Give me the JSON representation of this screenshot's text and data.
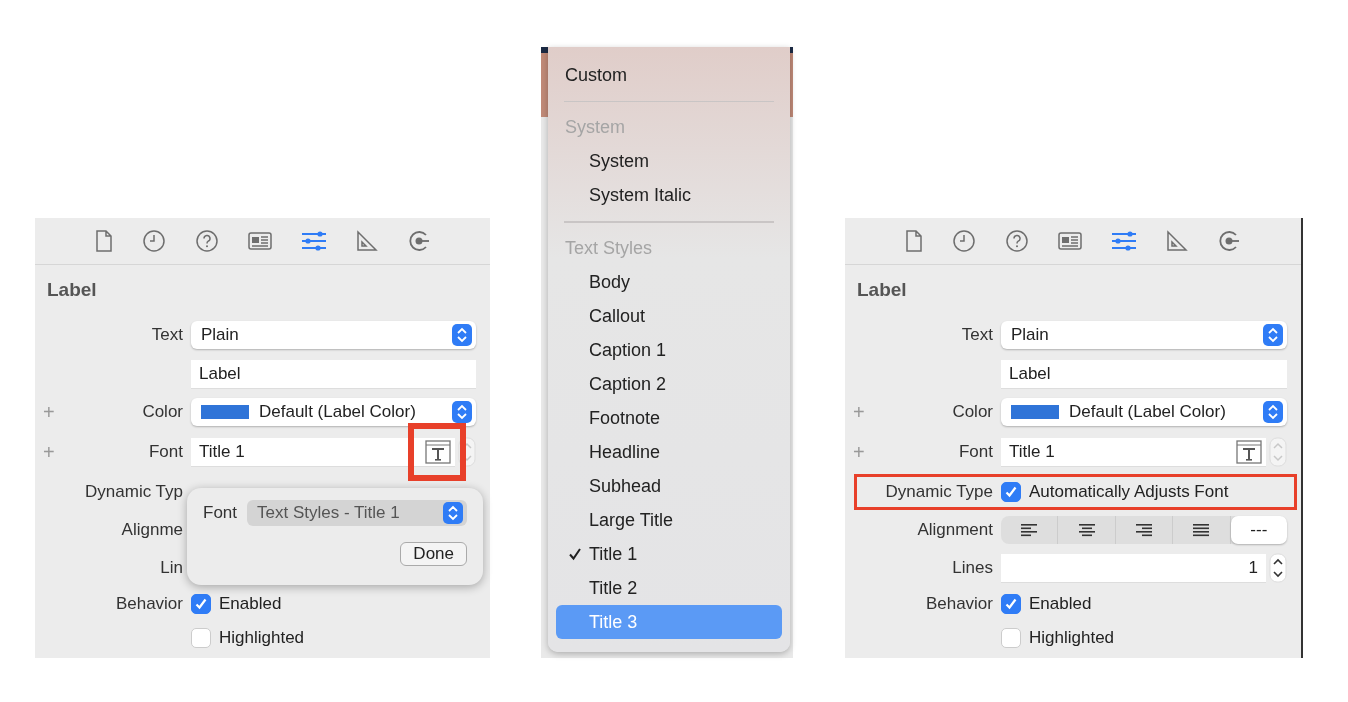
{
  "left_inspector": {
    "toolbar": [
      {
        "kind": "file",
        "selected": false
      },
      {
        "kind": "history",
        "selected": false
      },
      {
        "kind": "help",
        "selected": false
      },
      {
        "kind": "identity",
        "selected": false
      },
      {
        "kind": "attributes",
        "selected": true
      },
      {
        "kind": "size",
        "selected": false
      },
      {
        "kind": "connections",
        "selected": false
      }
    ],
    "title": "Label",
    "rows": [
      {
        "kind": "popup",
        "label": "Text",
        "value": "Plain"
      },
      {
        "kind": "text",
        "value": "Label"
      },
      {
        "kind": "color",
        "plus": "+",
        "label": "Color",
        "value": "Default (Label Color)"
      },
      {
        "kind": "font",
        "plus": "+",
        "label": "Font",
        "value": "Title 1",
        "highlighted": true
      },
      {
        "kind": "label_only",
        "label": "Dynamic Typ"
      },
      {
        "kind": "label_only",
        "label": "Alignme"
      },
      {
        "kind": "label_only",
        "label": "Lin"
      },
      {
        "kind": "check",
        "label": "Behavior",
        "text": "Enabled",
        "checked": true
      },
      {
        "kind": "check",
        "text": "Highlighted",
        "checked": false
      }
    ],
    "popover": {
      "label": "Font",
      "value": "Text Styles - Title 1",
      "button": "Done"
    }
  },
  "font_menu": {
    "items": [
      {
        "kind": "item",
        "text": "Custom",
        "checked": false,
        "selected": false,
        "indented": false
      },
      {
        "kind": "separator"
      },
      {
        "kind": "header",
        "text": "System"
      },
      {
        "kind": "item",
        "text": "System",
        "checked": false,
        "selected": false,
        "indented": true
      },
      {
        "kind": "item",
        "text": "System Italic",
        "checked": false,
        "selected": false,
        "indented": true
      },
      {
        "kind": "separator"
      },
      {
        "kind": "header",
        "text": "Text Styles"
      },
      {
        "kind": "item",
        "text": "Body",
        "checked": false,
        "selected": false,
        "indented": true
      },
      {
        "kind": "item",
        "text": "Callout",
        "checked": false,
        "selected": false,
        "indented": true
      },
      {
        "kind": "item",
        "text": "Caption 1",
        "checked": false,
        "selected": false,
        "indented": true
      },
      {
        "kind": "item",
        "text": "Caption 2",
        "checked": false,
        "selected": false,
        "indented": true
      },
      {
        "kind": "item",
        "text": "Footnote",
        "checked": false,
        "selected": false,
        "indented": true
      },
      {
        "kind": "item",
        "text": "Headline",
        "checked": false,
        "selected": false,
        "indented": true
      },
      {
        "kind": "item",
        "text": "Subhead",
        "checked": false,
        "selected": false,
        "indented": true
      },
      {
        "kind": "item",
        "text": "Large Title",
        "checked": false,
        "selected": false,
        "indented": true
      },
      {
        "kind": "item",
        "text": "Title 1",
        "checked": true,
        "selected": false,
        "indented": true
      },
      {
        "kind": "item",
        "text": "Title 2",
        "checked": false,
        "selected": false,
        "indented": true
      },
      {
        "kind": "item",
        "text": "Title 3",
        "checked": false,
        "selected": true,
        "indented": true
      }
    ]
  },
  "right_inspector": {
    "toolbar": [
      {
        "kind": "file",
        "selected": false
      },
      {
        "kind": "history",
        "selected": false
      },
      {
        "kind": "help",
        "selected": false
      },
      {
        "kind": "identity",
        "selected": false
      },
      {
        "kind": "attributes",
        "selected": true
      },
      {
        "kind": "size",
        "selected": false
      },
      {
        "kind": "connections",
        "selected": false
      }
    ],
    "title": "Label",
    "rows": [
      {
        "kind": "popup",
        "label": "Text",
        "value": "Plain"
      },
      {
        "kind": "text",
        "value": "Label"
      },
      {
        "kind": "color",
        "plus": "+",
        "label": "Color",
        "value": "Default (Label Color)"
      },
      {
        "kind": "font",
        "plus": "+",
        "label": "Font",
        "value": "Title 1",
        "highlighted": false
      },
      {
        "kind": "dynamic",
        "label": "Dynamic Type",
        "text": "Automatically Adjusts Font",
        "checked": true,
        "highlighted": true
      },
      {
        "kind": "align",
        "label": "Alignment",
        "segments": [
          {
            "kind": "left",
            "selected": false
          },
          {
            "kind": "center",
            "selected": false
          },
          {
            "kind": "right",
            "selected": false
          },
          {
            "kind": "justified",
            "selected": false
          },
          {
            "kind": "natural",
            "text": "---",
            "selected": true
          }
        ]
      },
      {
        "kind": "lines",
        "label": "Lines",
        "value": "1"
      },
      {
        "kind": "check",
        "label": "Behavior",
        "text": "Enabled",
        "checked": true
      },
      {
        "kind": "check",
        "text": "Highlighted",
        "checked": false
      }
    ]
  }
}
